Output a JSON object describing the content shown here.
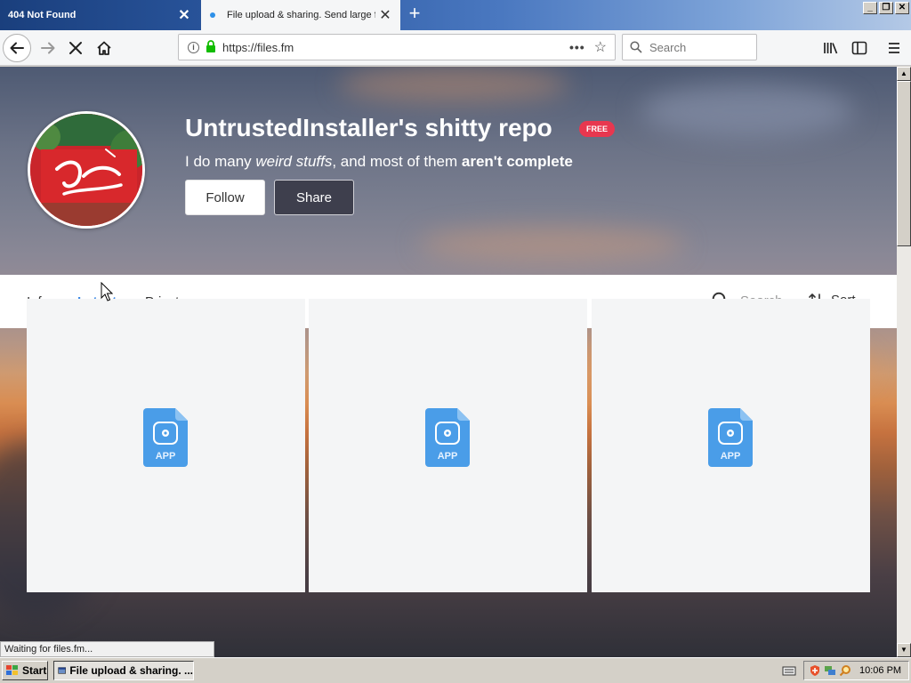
{
  "browser": {
    "tabs": [
      {
        "title": "404 Not Found",
        "active": false
      },
      {
        "title": "File upload & sharing. Send large files",
        "active": true
      }
    ],
    "address": {
      "url": "https://files.fm"
    },
    "search": {
      "placeholder": "Search"
    },
    "window_buttons": [
      "_",
      "❐",
      "✕"
    ]
  },
  "profile": {
    "title": "UntrustedInstaller's shitty repo",
    "badge": "FREE",
    "desc_part1": "I do many ",
    "desc_italic": "weird stuffs",
    "desc_part2": ", and most of them ",
    "desc_bold": "aren't complete",
    "follow_label": "Follow",
    "share_label": "Share"
  },
  "subnav": {
    "tabs": [
      {
        "label": "Info",
        "active": false
      },
      {
        "label": "Latest",
        "active": true
      },
      {
        "label": "Private",
        "active": false
      }
    ],
    "search_placeholder": "Search",
    "sort_label": "Sort"
  },
  "files": [
    {
      "type_label": "APP"
    },
    {
      "type_label": "APP"
    },
    {
      "type_label": "APP"
    }
  ],
  "status": {
    "text": "Waiting for files.fm..."
  },
  "taskbar": {
    "start_label": "Start",
    "task_label": "File upload & sharing. ...",
    "clock": "10:06 PM"
  },
  "colors": {
    "accent": "#3e8ae6",
    "badge": "#e8374f",
    "file_icon": "#4a9de8"
  }
}
